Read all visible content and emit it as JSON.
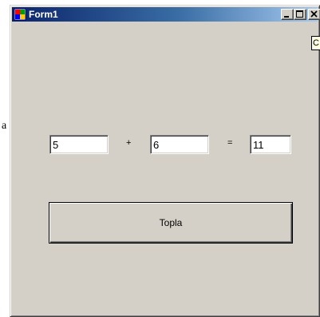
{
  "stray_text": "a",
  "window": {
    "title": "Form1",
    "icon": "form-app-icon",
    "controls": {
      "minimize_icon": "minimize-icon",
      "maximize_icon": "maximize-icon",
      "close_icon": "close-icon"
    }
  },
  "form": {
    "corner_label": "C",
    "operand1": "5",
    "plus_label": "+",
    "operand2": "6",
    "equals_label": "=",
    "result": "11",
    "add_button_label": "Topla"
  },
  "colors": {
    "titlebar_start": "#0a246a",
    "titlebar_end": "#a6caf0",
    "face": "#d4d0c8"
  }
}
